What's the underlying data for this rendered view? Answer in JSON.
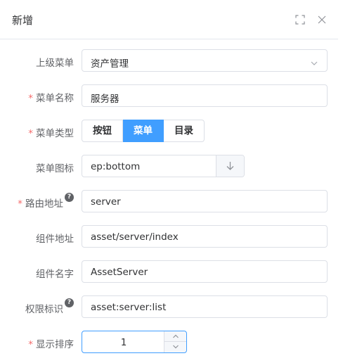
{
  "dialog": {
    "title": "新增",
    "maximize_icon": "fullscreen-icon",
    "close_icon": "close-icon"
  },
  "form": {
    "parent_menu": {
      "label": "上级菜单",
      "value": "资产管理",
      "icon": "chevron-down-icon"
    },
    "menu_name": {
      "label": "菜单名称",
      "required": "*",
      "value": "服务器"
    },
    "menu_type": {
      "label": "菜单类型",
      "required": "*",
      "options": [
        "按钮",
        "菜单",
        "目录"
      ],
      "selected": "菜单"
    },
    "menu_icon": {
      "label": "菜单图标",
      "value": "ep:bottom",
      "icon": "arrow-down-icon"
    },
    "route_path": {
      "label": "路由地址",
      "required": "*",
      "help": "?",
      "value": "server"
    },
    "component_path": {
      "label": "组件地址",
      "value": "asset/server/index"
    },
    "component_name": {
      "label": "组件名字",
      "value": "AssetServer"
    },
    "permission": {
      "label": "权限标识",
      "help": "?",
      "value": "asset:server:list"
    },
    "sort": {
      "label": "显示排序",
      "required": "*",
      "value": "1"
    }
  },
  "colors": {
    "primary": "#409eff",
    "required": "#f56c6c",
    "border": "#dcdfe6",
    "label": "#606266",
    "text": "#303133"
  }
}
